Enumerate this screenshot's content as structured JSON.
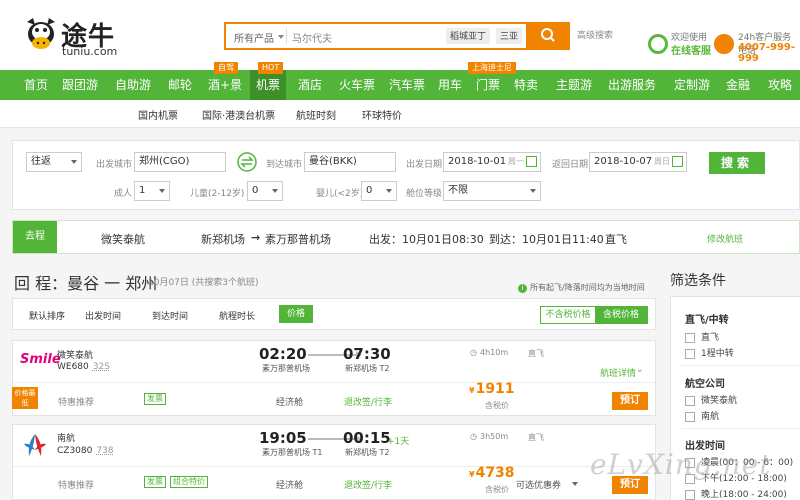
{
  "brand": {
    "name_cn": "途牛",
    "name_en": "tuniu.com"
  },
  "search": {
    "category": "所有产品",
    "value": "马尔代夫",
    "tags": [
      "稻城亚丁",
      "三亚"
    ],
    "advanced": "高级搜索"
  },
  "service": {
    "online_small": "欢迎使用",
    "online_big": "在线客服",
    "phone_small": "24h客户服务电话",
    "phone_big": "4007-999-999"
  },
  "nav": {
    "items": [
      "首页",
      "跟团游",
      "自助游",
      "邮轮",
      "酒+景",
      "机票",
      "酒店",
      "火车票",
      "汽车票",
      "用车",
      "门票",
      "特卖",
      "主题游",
      "出游服务",
      "定制游",
      "金融",
      "攻略"
    ],
    "badges": {
      "hotel_scenic": "自驾",
      "flight": "HOT",
      "ticket": "上海迪士尼"
    }
  },
  "subnav": [
    "国内机票",
    "国际·港澳台机票",
    "航班时刻",
    "环球特价"
  ],
  "form": {
    "trip_type": "往返",
    "from_label": "出发城市",
    "from_value": "郑州(CGO)",
    "to_label": "到达城市",
    "to_value": "曼谷(BKK)",
    "depart_label": "出发日期",
    "depart_value": "2018-10-01",
    "depart_hint": "周一",
    "return_label": "返回日期",
    "return_value": "2018-10-07",
    "return_hint": "周日",
    "adult_label": "成人",
    "adult_value": "1",
    "child_label": "儿童(2-12岁)",
    "child_value": "0",
    "infant_label": "婴儿(<2岁)",
    "infant_value": "0",
    "cabin_label": "舱位等级",
    "cabin_value": "不限",
    "search_button": "搜索"
  },
  "selected": {
    "tag": "去程",
    "airline": "微笑泰航",
    "route_from": "新郑机场",
    "route_to": "素万那普机场",
    "depart": "出发：10月01日08:30",
    "arrive": "到达：10月01日11:40",
    "type": "直飞",
    "change": "修改航班"
  },
  "return_header": {
    "title": "回 程：曼谷 一 郑州",
    "subtitle": "10月07日 (共搜索3个航班)",
    "notice": "所有起飞/降落时间均为当地时间"
  },
  "sortbar": {
    "items": [
      "默认排序",
      "出发时间",
      "到达时间",
      "航程时长"
    ],
    "price": "价格",
    "toggle_off": "不含税价格",
    "toggle_on": "含税价格"
  },
  "flights": [
    {
      "airline": "微笑泰航",
      "logo_text": "Smile",
      "flight_no": "WE680",
      "aircraft": "32S",
      "dep_time": "02:20",
      "dep_airport": "素万那普机场",
      "arr_time": "07:30",
      "arr_day": "",
      "arr_airport": "新郑机场 T2",
      "duration": "4h10m",
      "direct": "直飞",
      "detail": "航班详情",
      "price_badge": "价格最低",
      "promo": "特惠推荐",
      "badges": [
        "发票"
      ],
      "cabin": "经济舱",
      "refund": "退改签/行李",
      "price": "1911",
      "price_note": "含税价",
      "coupon": "",
      "book": "预订"
    },
    {
      "airline": "南航",
      "logo_text": "",
      "flight_no": "CZ3080",
      "aircraft": "738",
      "dep_time": "19:05",
      "dep_airport": "素万那普机场 T1",
      "arr_time": "00:15",
      "arr_day": "+1天",
      "arr_airport": "新郑机场 T2",
      "duration": "3h50m",
      "direct": "直飞",
      "detail": "",
      "price_badge": "",
      "promo": "特惠推荐",
      "badges": [
        "发票",
        "组合特价"
      ],
      "cabin": "经济舱",
      "refund": "退改签/行李",
      "price": "4738",
      "price_note": "含税价",
      "coupon": "可选优惠券",
      "book": "预订"
    }
  ],
  "filter": {
    "title": "筛选条件",
    "groups": [
      {
        "heading": "直飞/中转",
        "options": [
          "直飞",
          "1程中转"
        ]
      },
      {
        "heading": "航空公司",
        "options": [
          "微笑泰航",
          "南航"
        ]
      },
      {
        "heading": "出发时间",
        "options": [
          "凌晨(00：00 - 6：00)",
          "下午(12:00 - 18:00)",
          "晚上(18:00 - 24:00)"
        ]
      }
    ]
  },
  "watermark": "eLvXing.net",
  "colors": {
    "brand_green": "#52b53a",
    "accent_orange": "#f08300"
  }
}
